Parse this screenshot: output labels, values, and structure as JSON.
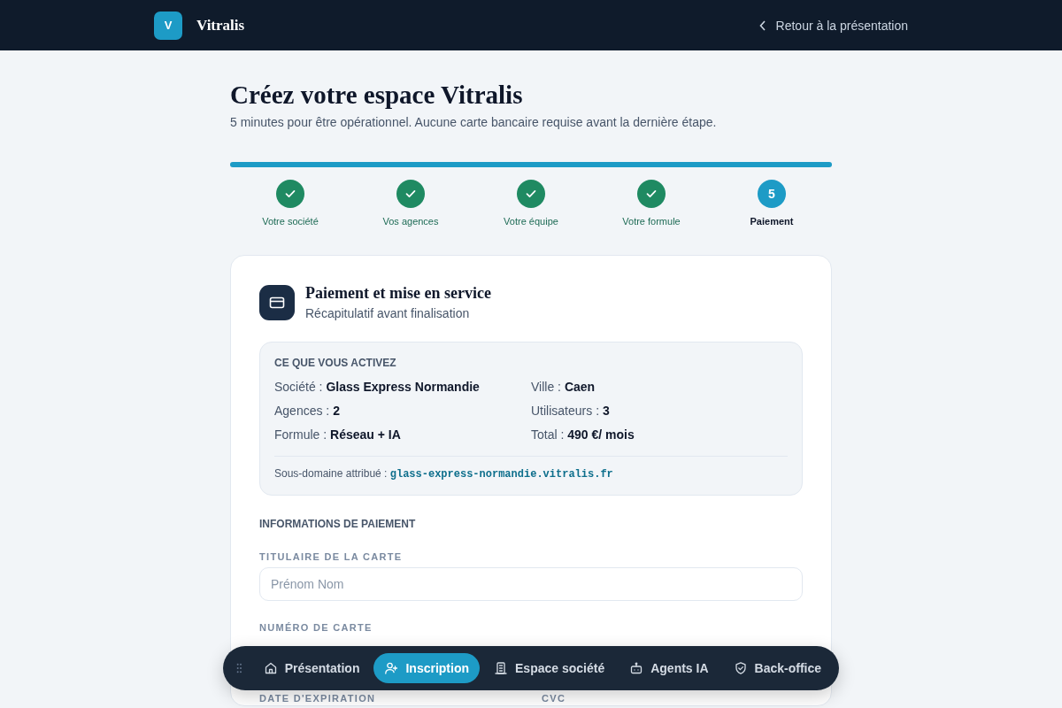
{
  "header": {
    "logo_letter": "V",
    "brand": "Vitralis",
    "back_link": "Retour à la présentation"
  },
  "title": "Créez votre espace Vitralis",
  "subtitle": "5 minutes pour être opérationnel. Aucune carte bancaire requise avant la dernière étape.",
  "progress": {
    "level": 1
  },
  "steps": [
    {
      "label": "Votre société",
      "done": true,
      "selected": false
    },
    {
      "label": "Vos agences",
      "done": true,
      "selected": false
    },
    {
      "label": "Votre équipe",
      "done": true,
      "selected": false
    },
    {
      "label": "Votre formule",
      "done": true,
      "selected": false
    },
    {
      "label": "Paiement",
      "done": false,
      "selected": true,
      "number": "5"
    }
  ],
  "card": {
    "title": "Paiement et mise en service",
    "subtitle": "Récapitulatif avant finalisation",
    "summary": {
      "heading": "CE QUE VOUS ACTIVEZ",
      "items": [
        {
          "label": "Société :",
          "value": "Glass Express Normandie"
        },
        {
          "label": "Ville :",
          "value": "Caen"
        },
        {
          "label": "Agences :",
          "value": "2"
        },
        {
          "label": "Utilisateurs :",
          "value": "3"
        },
        {
          "label": "Formule :",
          "value": "Réseau + IA"
        },
        {
          "label": "Total :",
          "value": "490 €/ mois"
        }
      ],
      "subdomain_label": "Sous-domaine attribué :",
      "subdomain": "glass-express-normandie.vitralis.fr"
    },
    "section_heading": "INFORMATIONS DE PAIEMENT",
    "fields": [
      {
        "label": "TITULAIRE DE LA CARTE",
        "placeholder": "Prénom Nom"
      },
      {
        "label": "NUMÉRO DE CARTE"
      }
    ],
    "bottom_labels": [
      "DATE D'EXPIRATION",
      "CVC"
    ]
  },
  "dock": [
    {
      "label": "Présentation",
      "selected": false
    },
    {
      "label": "Inscription",
      "selected": true
    },
    {
      "label": "Espace société",
      "selected": false
    },
    {
      "label": "Agents IA",
      "selected": false
    },
    {
      "label": "Back-office",
      "selected": false
    }
  ]
}
